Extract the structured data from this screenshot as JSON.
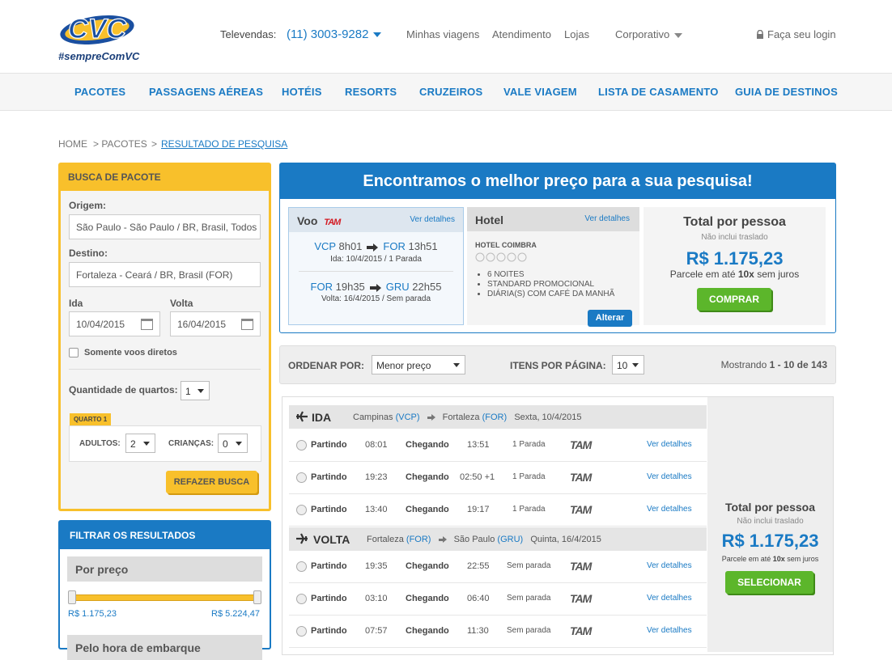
{
  "header": {
    "logo_text": "CVC",
    "tagline": "#sempreComVC",
    "televendas_label": "Televendas:",
    "phone": "(11) 3003-9282",
    "links": [
      "Minhas viagens",
      "Atendimento",
      "Lojas"
    ],
    "corporativo": "Corporativo",
    "login": "Faça seu login"
  },
  "nav": [
    "PACOTES",
    "PASSAGENS AÉREAS",
    "HOTÉIS",
    "RESORTS",
    "CRUZEIROS",
    "VALE VIAGEM",
    "LISTA DE CASAMENTO",
    "GUIA DE DESTINOS"
  ],
  "breadcrumb": [
    "HOME",
    "> PACOTES",
    "> ",
    "RESULTADO DE PESQUISA"
  ],
  "search": {
    "title": "BUSCA DE PACOTE",
    "origin_label": "Origem:",
    "origin_value": "São Paulo - São Paulo / BR, Brasil, Todos",
    "dest_label": "Destino:",
    "dest_value": "Fortaleza - Ceará / BR, Brasil (FOR)",
    "ida_label": "Ida",
    "ida_value": "10/04/2015",
    "volta_label": "Volta",
    "volta_value": "16/04/2015",
    "direct_label": "Somente voos diretos",
    "rooms_label": "Quantidade de quartos:",
    "rooms_value": "1",
    "room_tag": "QUARTO 1",
    "adults_label": "ADULTOS:",
    "adults_value": "2",
    "children_label": "CRIANÇAS:",
    "children_value": "0",
    "submit": "REFAZER BUSCA"
  },
  "filter": {
    "title": "FILTRAR OS RESULTADOS",
    "price_header": "Por preço",
    "min": "R$ 1.175,23",
    "max": "R$ 5.224,47",
    "next_header": "Pelo hora de embarque"
  },
  "best": {
    "title": "Encontramos o melhor preço para a sua pesquisa!",
    "voo_label": "Voo",
    "details": "Ver detalhes",
    "out_from": "VCP",
    "out_dep": "8h01",
    "out_to": "FOR",
    "out_arr": "13h51",
    "out_info": "Ida: 10/4/2015 /  1 Parada",
    "ret_from": "FOR",
    "ret_dep": "19h35",
    "ret_to": "GRU",
    "ret_arr": "22h55",
    "ret_info": "Volta: 16/4/2015 / Sem parada",
    "hotel_label": "Hotel",
    "hotel_name": "HOTEL COIMBRA",
    "hotel_items": [
      "6 NOITES",
      "STANDARD PROMOCIONAL",
      "DIÁRIA(S) COM CAFÉ DA MANHÃ"
    ],
    "alterar": "Alterar",
    "total_label": "Total por pessoa",
    "no_transfer": "Não inclui traslado",
    "price": "R$ 1.175,23",
    "installments_pre": "Parcele em até ",
    "installments_bold": "10x",
    "installments_post": " sem juros",
    "buy": "COMPRAR"
  },
  "sort": {
    "order_label": "ORDENAR POR:",
    "order_value": "Menor preço",
    "items_label": "ITENS POR PÁGINA:",
    "items_value": "10",
    "showing_pre": "Mostrando ",
    "showing_range": "1 - 10 de 143"
  },
  "results": {
    "ida": {
      "label": "IDA",
      "from": "Campinas",
      "from_code": "(VCP)",
      "to": "Fortaleza",
      "to_code": "(FOR)",
      "date": "Sexta, 10/4/2015"
    },
    "volta": {
      "label": "VOLTA",
      "from": "Fortaleza",
      "from_code": "(FOR)",
      "to": "São Paulo",
      "to_code": "(GRU)",
      "date": "Quinta, 16/4/2015"
    },
    "partindo": "Partindo",
    "chegando": "Chegando",
    "airline": "TAM",
    "details": "Ver detalhes",
    "ida_rows": [
      {
        "dep": "08:01",
        "arr": "13:51",
        "stops": "1 Parada"
      },
      {
        "dep": "19:23",
        "arr": "02:50 +1",
        "stops": "1 Parada"
      },
      {
        "dep": "13:40",
        "arr": "19:17",
        "stops": "1 Parada"
      }
    ],
    "volta_rows": [
      {
        "dep": "19:35",
        "arr": "22:55",
        "stops": "Sem parada"
      },
      {
        "dep": "03:10",
        "arr": "06:40",
        "stops": "Sem parada"
      },
      {
        "dep": "07:57",
        "arr": "11:30",
        "stops": "Sem parada"
      }
    ],
    "side": {
      "total_label": "Total por pessoa",
      "no_transfer": "Não inclui traslado",
      "price": "R$ 1.175,23",
      "inst_pre": "Parcele em até ",
      "inst_bold": "10x",
      "inst_post": " sem juros",
      "select": "SELECIONAR"
    }
  },
  "colors": {
    "brand_blue": "#1a7ac4",
    "brand_yellow": "#f8c02b",
    "buy_green": "#5cb62b",
    "tam_red": "#d41c24"
  }
}
